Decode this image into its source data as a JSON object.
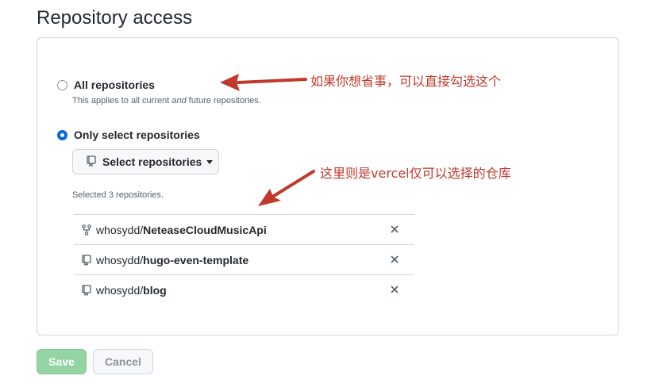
{
  "section": {
    "title": "Repository access"
  },
  "options": {
    "all": {
      "label": "All repositories",
      "note_before": "This applies to all current ",
      "note_em": "and",
      "note_after": " future repositories.",
      "checked": false
    },
    "select": {
      "label": "Only select repositories",
      "checked": true
    }
  },
  "select_button": {
    "label": "Select repositories",
    "icon": "repo-icon"
  },
  "selected_count": "Selected 3 repositories.",
  "repos": [
    {
      "owner": "whosydd/",
      "name": "NeteaseCloudMusicApi",
      "icon": "fork-icon"
    },
    {
      "owner": "whosydd/",
      "name": "hugo-even-template",
      "icon": "repo-icon"
    },
    {
      "owner": "whosydd/",
      "name": "blog",
      "icon": "repo-icon"
    }
  ],
  "buttons": {
    "save": "Save",
    "cancel": "Cancel"
  },
  "annotations": {
    "first": "如果你想省事，可以直接勾选这个",
    "second": "这里则是vercel仅可以选择的仓库",
    "color": "#c0392b"
  },
  "colors": {
    "accent": "#0969da",
    "save_disabled": "#94d3a2",
    "border": "#d0d7de"
  }
}
